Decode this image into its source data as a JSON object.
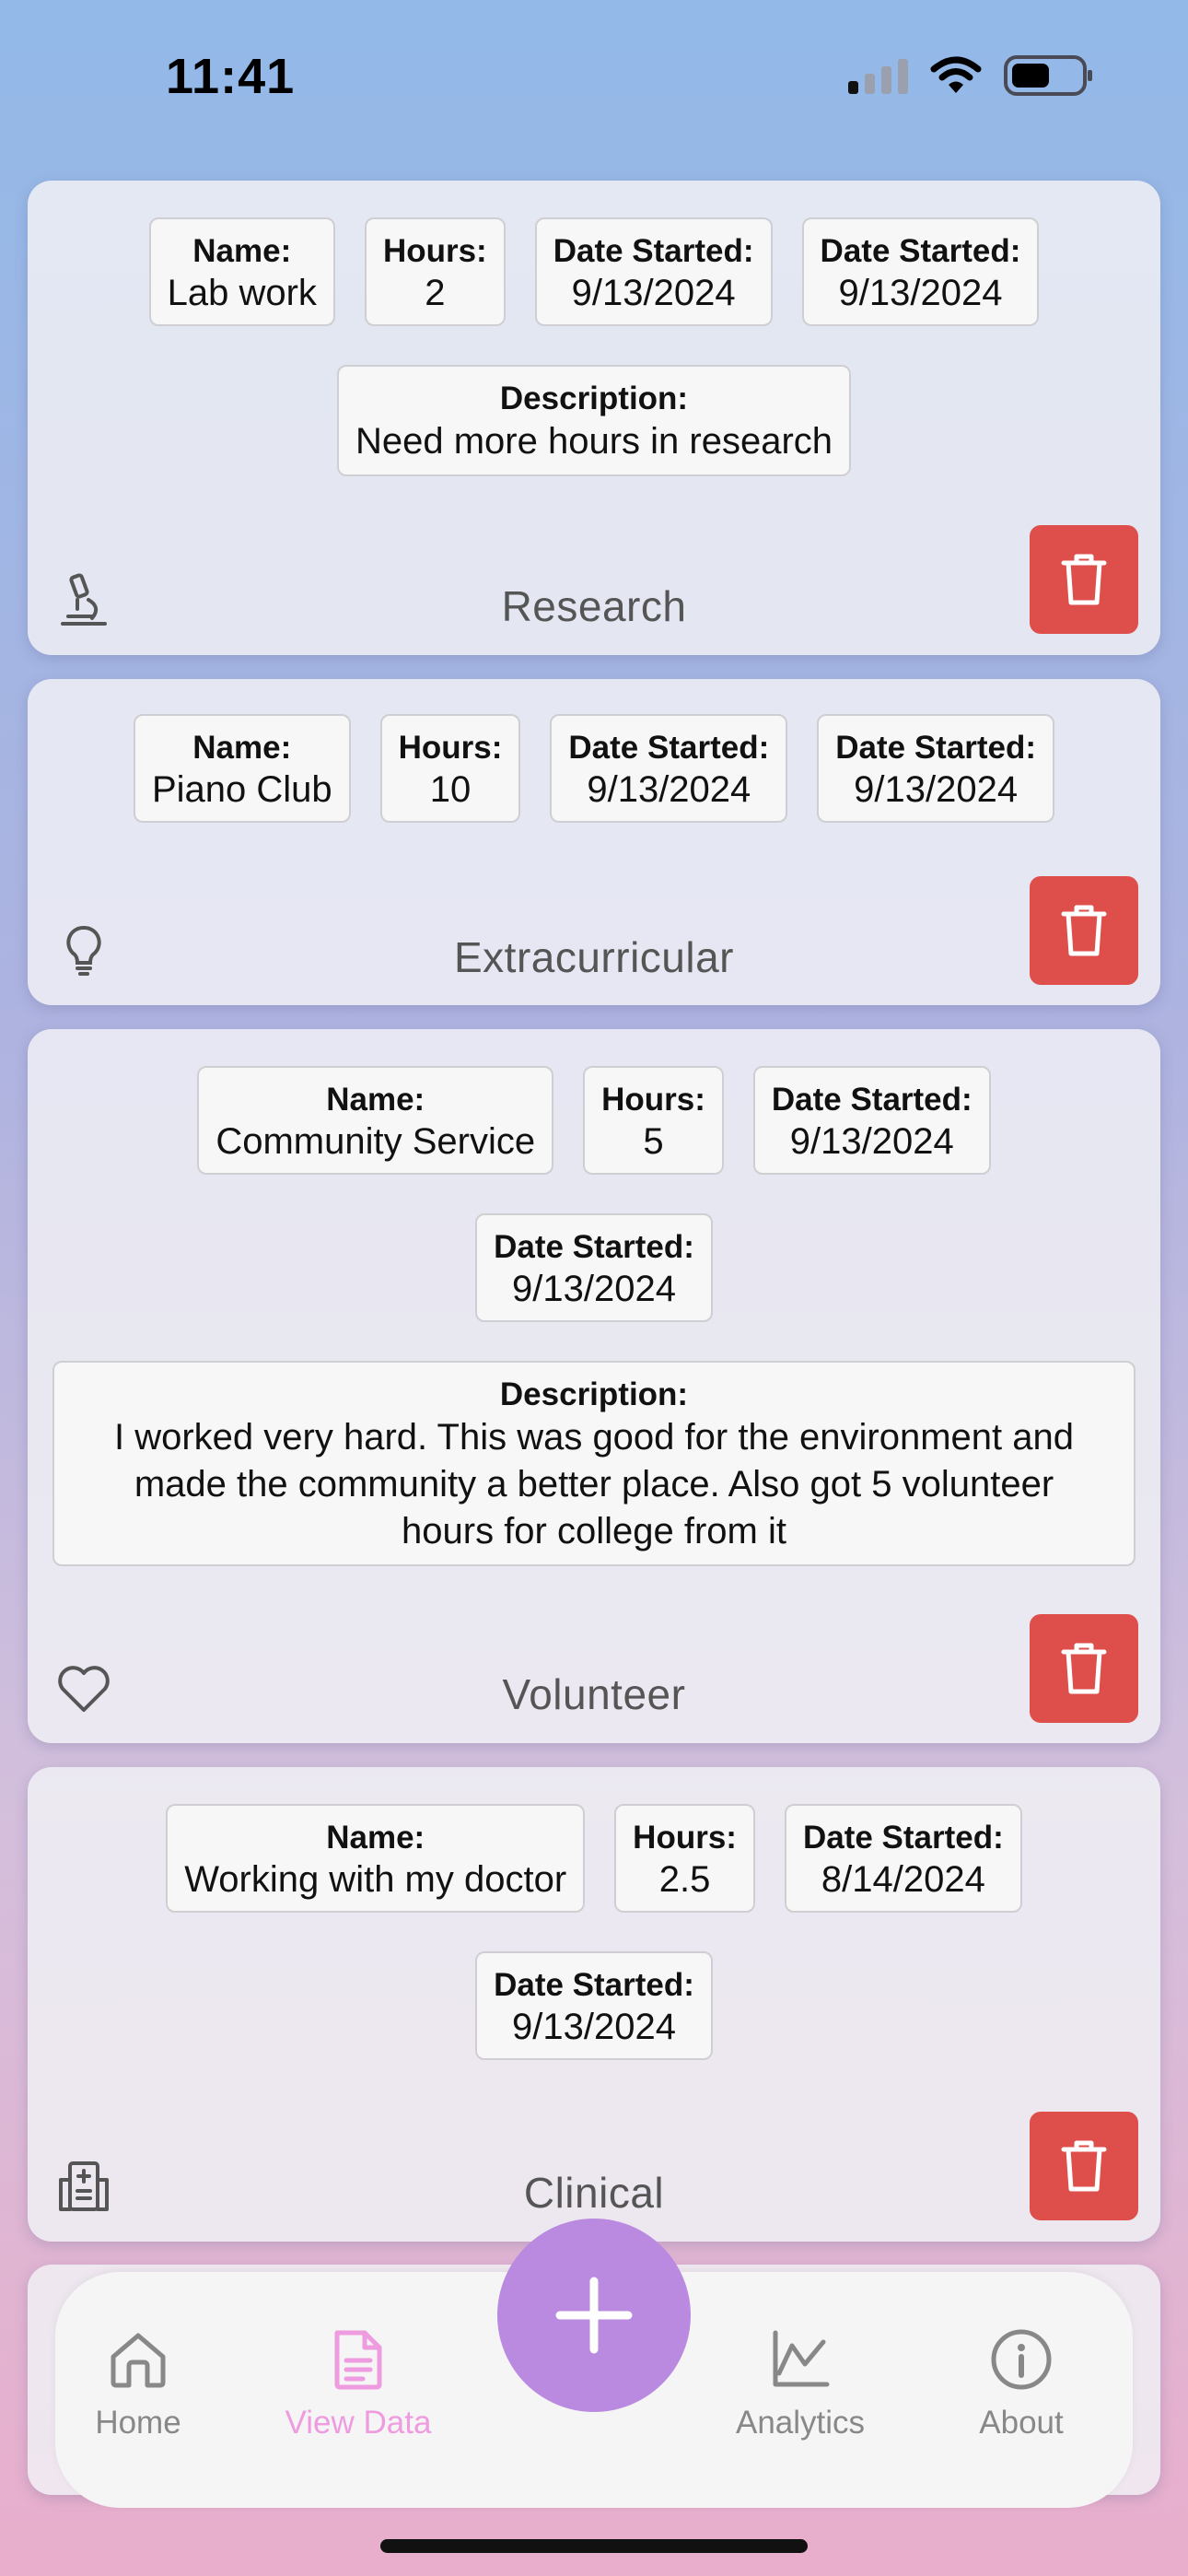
{
  "status_bar": {
    "time": "11:41"
  },
  "entries": [
    {
      "fields": [
        {
          "label": "Name:",
          "value": "Lab work"
        },
        {
          "label": "Hours:",
          "value": "2"
        },
        {
          "label": "Date Started:",
          "value": "9/13/2024"
        },
        {
          "label": "Date Started:",
          "value": "9/13/2024"
        }
      ],
      "description": {
        "label": "Description:",
        "value": "Need more hours in research"
      },
      "category": "Research",
      "category_icon": "microscope-icon"
    },
    {
      "fields": [
        {
          "label": "Name:",
          "value": "Piano Club"
        },
        {
          "label": "Hours:",
          "value": "10"
        },
        {
          "label": "Date Started:",
          "value": "9/13/2024"
        },
        {
          "label": "Date Started:",
          "value": "9/13/2024"
        }
      ],
      "category": "Extracurricular",
      "category_icon": "lightbulb-icon"
    },
    {
      "fields": [
        {
          "label": "Name:",
          "value": "Community Service"
        },
        {
          "label": "Hours:",
          "value": "5"
        },
        {
          "label": "Date Started:",
          "value": "9/13/2024"
        },
        {
          "label": "Date Started:",
          "value": "9/13/2024"
        }
      ],
      "description": {
        "label": "Description:",
        "lines": [
          "I worked very hard. This was good for the environment and",
          "made the community a better place. Also got 5 volunteer",
          "hours for college from it"
        ]
      },
      "category": "Volunteer",
      "category_icon": "heart-icon"
    },
    {
      "fields": [
        {
          "label": "Name:",
          "value": "Working with my doctor"
        },
        {
          "label": "Hours:",
          "value": "2.5"
        },
        {
          "label": "Date Started:",
          "value": "8/14/2024"
        },
        {
          "label": "Date Started:",
          "value": "9/13/2024"
        }
      ],
      "category": "Clinical",
      "category_icon": "hospital-icon"
    }
  ],
  "tabs": [
    {
      "label": "Home",
      "icon": "home-icon",
      "active": false
    },
    {
      "label": "View Data",
      "icon": "document-icon",
      "active": true
    },
    {
      "label": "Analytics",
      "icon": "chart-icon",
      "active": false
    },
    {
      "label": "About",
      "icon": "info-icon",
      "active": false
    }
  ],
  "colors": {
    "delete_button": "#de4e4b",
    "add_button": "#b98adf",
    "active_tab": "#ef9bdf",
    "inactive_tab": "#888888"
  },
  "add_button_icon": "plus-icon",
  "delete_button_icon": "trash-icon"
}
